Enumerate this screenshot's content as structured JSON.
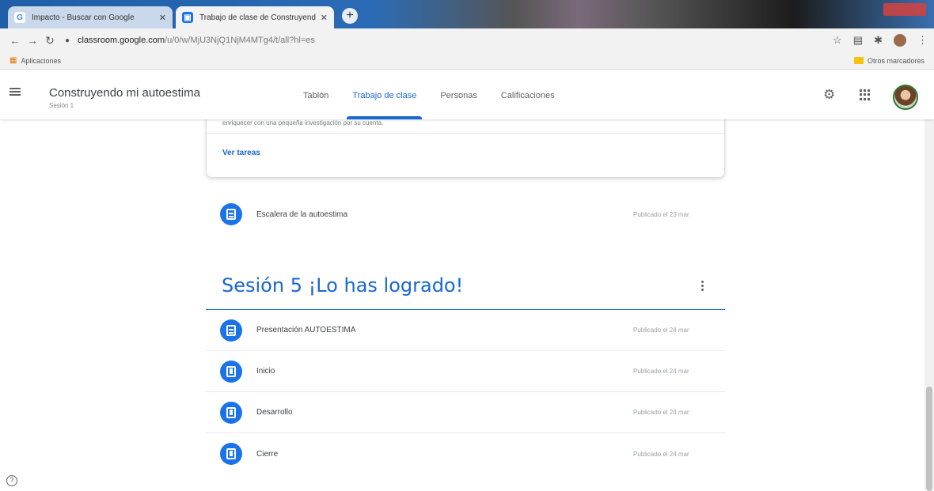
{
  "browser": {
    "tabs": [
      {
        "label": "Impacto - Buscar con Google",
        "favicon": "G",
        "active": false
      },
      {
        "label": "Trabajo de clase de Construyendo",
        "favicon": "▣",
        "active": true
      }
    ],
    "close_glyph": "✕",
    "new_tab_glyph": "+",
    "url_host": "classroom.google.com",
    "url_path": "/u/0/w/MjU3NjQ1NjM4MTg4/t/all?hl=es",
    "bookmarks": {
      "apps": "Aplicaciones",
      "other": "Otros marcadores"
    }
  },
  "classroom": {
    "class_title": "Construyendo mi autoestima",
    "class_subtitle": "Sesión 1",
    "tabs": [
      "Tablón",
      "Trabajo de clase",
      "Personas",
      "Calificaciones"
    ],
    "selected_tab": "Trabajo de clase"
  },
  "content": {
    "previous_card": {
      "description": "enriquecer con una pequeña investigación por su cuenta.",
      "view_link": "Ver tareas"
    },
    "loose_item": {
      "title": "Escalera de la autoestima",
      "date": "Publicado el 23 mar",
      "icon": "material-icon"
    },
    "topic": {
      "title": "Sesión 5 ¡Lo has logrado!",
      "items": [
        {
          "title": "Presentación AUTOESTIMA",
          "date": "Publicado el 24 mar",
          "icon": "material-icon"
        },
        {
          "title": "Inicio",
          "date": "Publicado el 24 mar",
          "icon": "assignment-icon"
        },
        {
          "title": "Desarrollo",
          "date": "Publicado el 24 mar",
          "icon": "assignment-icon"
        },
        {
          "title": "Cierre",
          "date": "Publicado el 24 mar",
          "icon": "assignment-icon"
        }
      ]
    }
  },
  "help_glyph": "?"
}
